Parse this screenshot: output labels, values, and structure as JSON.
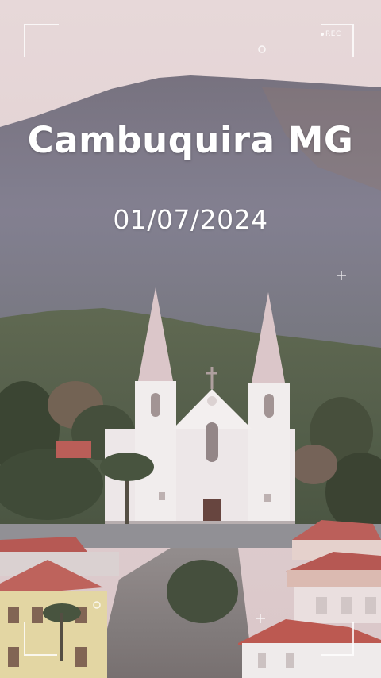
{
  "caption": {
    "title": "Cambuquira MG",
    "date": "01/07/2024"
  },
  "viewfinder": {
    "rec_label": "REC",
    "frame_color": "#ffffff",
    "icons": [
      "rec-dot-icon",
      "focus-crosshair-icon",
      "focus-circle-icon"
    ]
  },
  "palette": {
    "sky": "#e3d2d3",
    "mountain": "#7d7989",
    "hill": "#4e5a44",
    "church": "#efe9ea",
    "roof": "#b4524b"
  }
}
